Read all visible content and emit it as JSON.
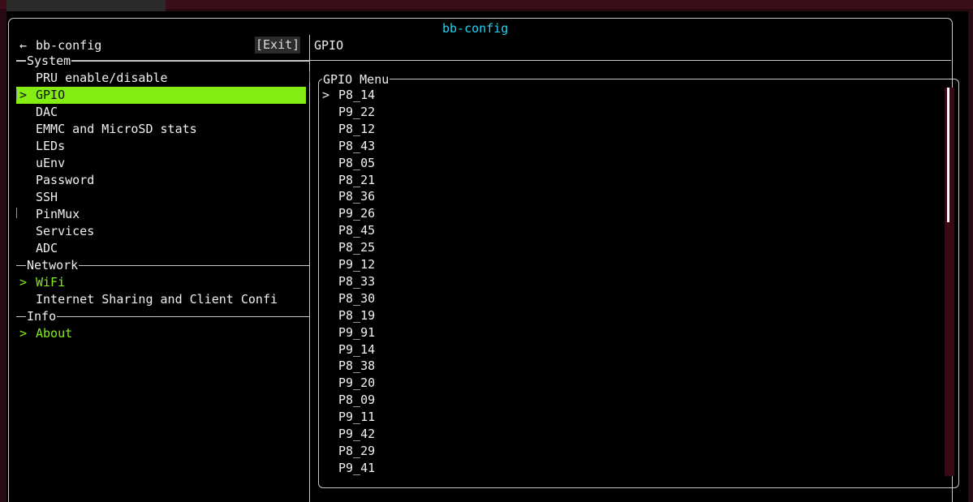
{
  "window": {
    "title": "bb-config"
  },
  "header": {
    "back_icon": "←",
    "app_name": "bb-config",
    "exit_label": "[Exit]",
    "right_title": "GPIO"
  },
  "sidebar": {
    "sections": [
      {
        "label": "System",
        "items": [
          {
            "label": "PRU enable/disable"
          },
          {
            "label": "GPIO",
            "selected": true,
            "caret": ">"
          },
          {
            "label": "DAC"
          },
          {
            "label": "EMMC and MicroSD stats"
          },
          {
            "label": "LEDs"
          },
          {
            "label": "uEnv"
          },
          {
            "label": "Password"
          },
          {
            "label": "SSH"
          },
          {
            "label": "PinMux"
          },
          {
            "label": "Services"
          },
          {
            "label": "ADC"
          }
        ]
      },
      {
        "label": "Network",
        "items": [
          {
            "label": "WiFi",
            "accent": true,
            "caret": ">"
          },
          {
            "label": "Internet Sharing and Client Confi"
          }
        ]
      },
      {
        "label": "Info",
        "items": [
          {
            "label": "About",
            "accent": true,
            "caret": ">"
          }
        ]
      }
    ]
  },
  "gpio_menu": {
    "title": "GPIO Menu",
    "selected_caret": ">",
    "items": [
      "P8_14",
      "P9_22",
      "P8_12",
      "P8_43",
      "P8_05",
      "P8_21",
      "P8_36",
      "P9_26",
      "P8_45",
      "P8_25",
      "P9_12",
      "P8_33",
      "P8_30",
      "P8_19",
      "P9_91",
      "P9_14",
      "P8_38",
      "P9_20",
      "P8_09",
      "P9_11",
      "P9_42",
      "P8_29",
      "P9_41"
    ],
    "scroll_position": 0.0,
    "scroll_visible_fraction": 0.35
  },
  "colors": {
    "accent": "#84ee14",
    "title": "#22d3ee",
    "background": "#000000",
    "frame": "#2a0a12"
  }
}
